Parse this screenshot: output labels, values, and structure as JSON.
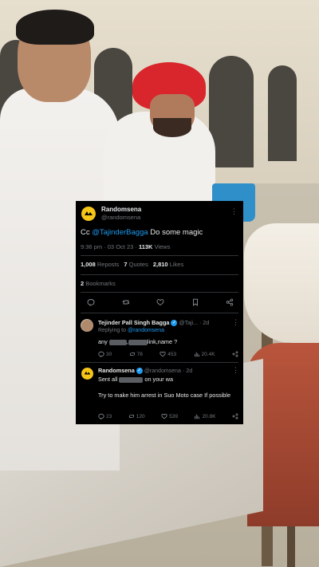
{
  "main_tweet": {
    "author_name": "Randomsena",
    "author_handle": "@randomsena",
    "text_prefix": "Cc ",
    "mention": "@TajinderBagga",
    "text_suffix": " Do some magic",
    "time": "9:36 pm · 03 Oct 23 · ",
    "views_count": "113K",
    "views_label": " Views",
    "reposts_count": "1,008",
    "reposts_label": " Reposts",
    "quotes_count": "7",
    "quotes_label": " Quotes",
    "likes_count": "2,810",
    "likes_label": " Likes",
    "bookmarks_count": "2",
    "bookmarks_label": " Bookmarks"
  },
  "reply1": {
    "author_name": "Tejinder Pall Singh Bagga",
    "author_handle": "@Taji...",
    "time": "· 2d",
    "replying_to_label": "Replying to ",
    "replying_to": "@randomsena",
    "text_start": "any ",
    "text_mid": ",",
    "text_end": "link,name ?",
    "replies": "30",
    "reposts": "78",
    "likes": "453",
    "views": "20.4K"
  },
  "reply2": {
    "author_name": "Randomsena",
    "author_handle": "@randomsena",
    "time": "· 2d",
    "line1_start": "Sent all ",
    "line1_end": " on your wa",
    "line2": "Try to make him arrest in Suo Moto case If possible",
    "replies": "23",
    "reposts": "120",
    "likes": "539",
    "views": "20.8K"
  },
  "icons": {
    "avatar_logo": "randomsena-logo-icon",
    "verified": "verified-badge-icon",
    "more": "more-options-icon"
  },
  "colors": {
    "accent": "#1d9bf0",
    "card_bg": "#000000",
    "muted": "#71767b"
  }
}
